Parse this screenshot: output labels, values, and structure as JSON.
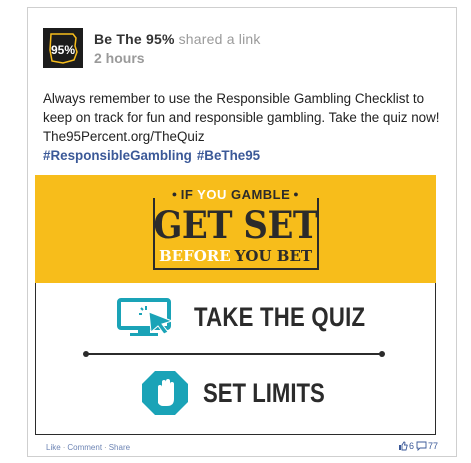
{
  "post": {
    "page_name": "Be The 95%",
    "action": "shared a link",
    "time": "2 hours",
    "avatar_text": "95%",
    "body_text": "Always remember to use the Responsible Gambling Checklist to keep on track for fun and responsible gambling. Take the quiz now! The95Percent.org/TheQuiz",
    "hashtags": [
      "#ResponsibleGambling",
      "#BeThe95"
    ]
  },
  "banner": {
    "if_prefix": "IF",
    "if_you": "YOU",
    "gamble": "GAMBLE",
    "get_set": "GET SET",
    "before": "BEFORE",
    "you_bet": "YOU BET",
    "quiz_label": "TAKE THE QUIZ",
    "limits_label": "SET LIMITS"
  },
  "footer": {
    "like": "Like",
    "comment": "Comment",
    "share": "Share",
    "separator": "·",
    "likes_count": "6",
    "comments_count": "77"
  },
  "colors": {
    "banner_yellow": "#f7bd1b",
    "teal": "#1aa3b7",
    "link_blue": "#3b5998"
  }
}
